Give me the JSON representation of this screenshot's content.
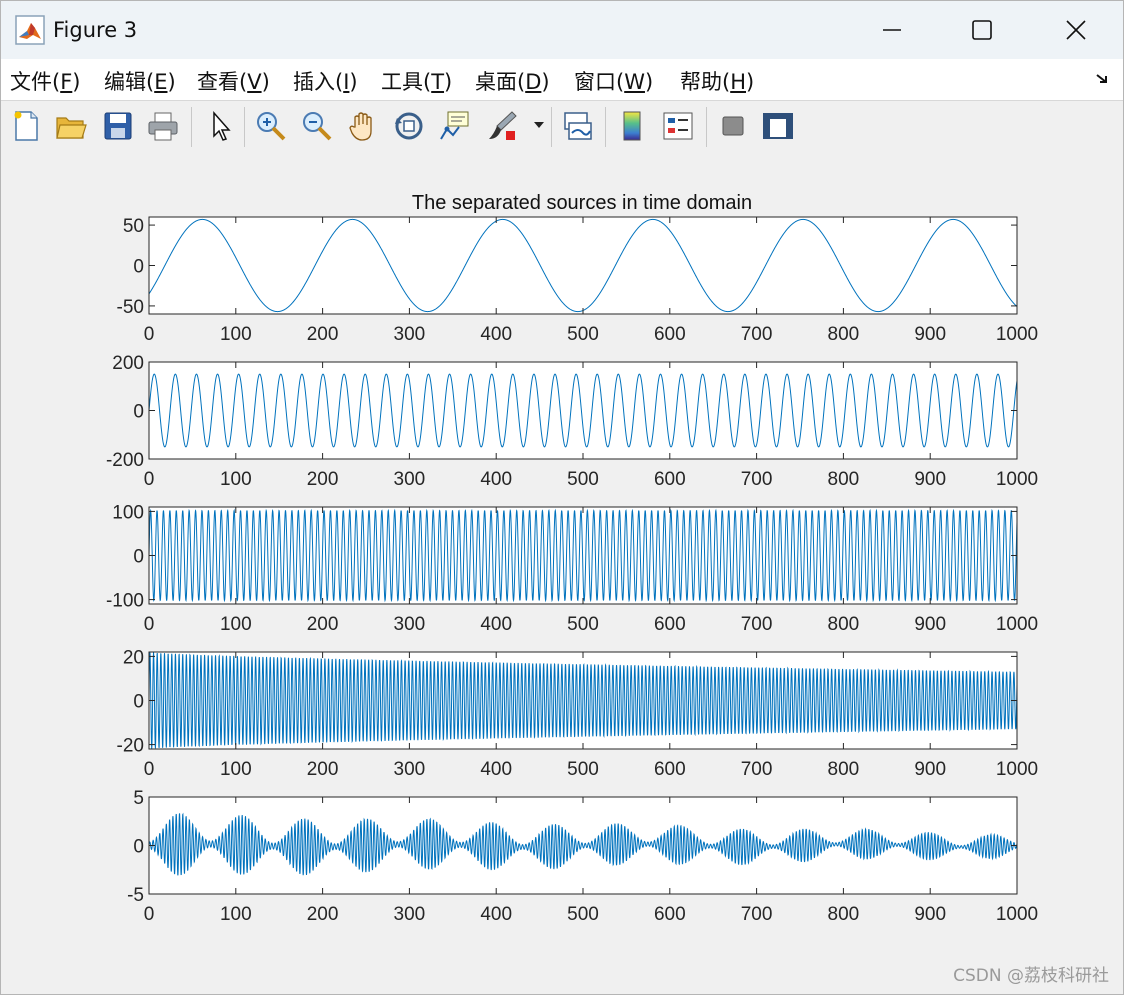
{
  "window": {
    "title": "Figure 3"
  },
  "menu": [
    {
      "label": "文件(",
      "key": "F",
      "close": ")"
    },
    {
      "label": "编辑(",
      "key": "E",
      "close": ")"
    },
    {
      "label": "查看(",
      "key": "V",
      "close": ")"
    },
    {
      "label": "插入(",
      "key": "I",
      "close": ")"
    },
    {
      "label": "工具(",
      "key": "T",
      "close": ")"
    },
    {
      "label": "桌面(",
      "key": "D",
      "close": ")"
    },
    {
      "label": "窗口(",
      "key": "W",
      "close": ")"
    },
    {
      "label": "帮助(",
      "key": "H",
      "close": ")"
    }
  ],
  "toolbar_icons": [
    "new-figure-icon",
    "open-file-icon",
    "save-icon",
    "print-icon",
    "edit-plot-arrow-icon",
    "zoom-in-icon",
    "zoom-out-icon",
    "pan-hand-icon",
    "rotate-3d-icon",
    "data-cursor-icon",
    "brush-icon",
    "link-plot-icon",
    "colorbar-icon",
    "legend-icon",
    "hide-plot-tools-icon",
    "show-plot-tools-icon"
  ],
  "colors": {
    "line": "#0072bd",
    "axes_bg": "#ffffff",
    "figure_bg": "#f0f0f0"
  },
  "chart_data": [
    {
      "type": "line",
      "title": "The separated sources in time domain",
      "xlim": [
        0,
        1000
      ],
      "ylim": [
        -60,
        60
      ],
      "xticks": [
        "0",
        "100",
        "200",
        "300",
        "400",
        "500",
        "600",
        "700",
        "800",
        "900",
        "1000"
      ],
      "yticks": [
        "50",
        "0",
        "-50"
      ],
      "ytick_values": [
        50,
        0,
        -50
      ],
      "series": [
        {
          "kind": "sine",
          "amplitude": 57,
          "period": 173,
          "phase_x": -25,
          "samples": 1000
        }
      ]
    },
    {
      "type": "line",
      "title": "",
      "xlim": [
        0,
        1000
      ],
      "ylim": [
        -200,
        200
      ],
      "xticks": [
        "0",
        "100",
        "200",
        "300",
        "400",
        "500",
        "600",
        "700",
        "800",
        "900",
        "1000"
      ],
      "yticks": [
        "200",
        "0",
        "-200"
      ],
      "ytick_values": [
        200,
        0,
        -200
      ],
      "series": [
        {
          "kind": "sine",
          "amplitude": 150,
          "period": 24.3,
          "phase_x": 0,
          "samples": 1000
        }
      ]
    },
    {
      "type": "line",
      "title": "",
      "xlim": [
        0,
        1000
      ],
      "ylim": [
        -110,
        110
      ],
      "xticks": [
        "0",
        "100",
        "200",
        "300",
        "400",
        "500",
        "600",
        "700",
        "800",
        "900",
        "1000"
      ],
      "yticks": [
        "100",
        "0",
        "-100"
      ],
      "ytick_values": [
        100,
        0,
        -100
      ],
      "series": [
        {
          "kind": "sine",
          "amplitude": 102,
          "period": 7.4,
          "phase_x": 0,
          "samples": 1000
        }
      ]
    },
    {
      "type": "line",
      "title": "",
      "xlim": [
        0,
        1000
      ],
      "ylim": [
        -22,
        22
      ],
      "xticks": [
        "0",
        "100",
        "200",
        "300",
        "400",
        "500",
        "600",
        "700",
        "800",
        "900",
        "1000"
      ],
      "yticks": [
        "20",
        "0",
        "-20"
      ],
      "ytick_values": [
        20,
        0,
        -20
      ],
      "series": [
        {
          "kind": "decaying",
          "amplitude_start": 22,
          "amplitude_end": 13,
          "period": 4.2,
          "samples": 1000
        }
      ]
    },
    {
      "type": "line",
      "title": "",
      "xlim": [
        0,
        1000
      ],
      "ylim": [
        -5,
        5
      ],
      "xticks": [
        "0",
        "100",
        "200",
        "300",
        "400",
        "500",
        "600",
        "700",
        "800",
        "900",
        "1000"
      ],
      "yticks": [
        "5",
        "0",
        "-5"
      ],
      "ytick_values": [
        5,
        0,
        -5
      ],
      "series": [
        {
          "kind": "beating",
          "amplitude_start": 3.3,
          "amplitude_end": 1.2,
          "beat_period": 72,
          "period": 3.8,
          "samples": 1000
        }
      ]
    }
  ],
  "watermark": "CSDN @荔枝科研社"
}
